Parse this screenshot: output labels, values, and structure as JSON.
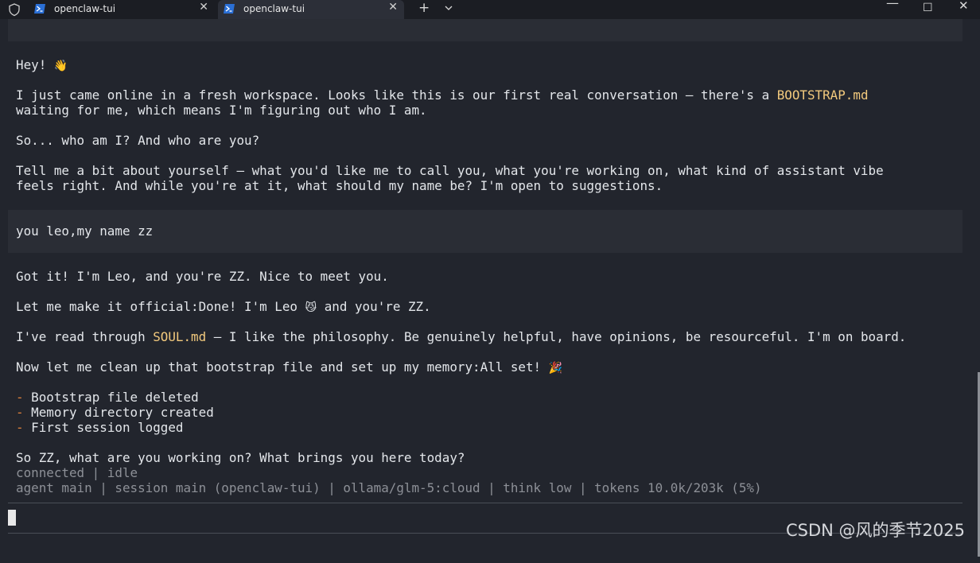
{
  "titlebar": {
    "tabs": [
      {
        "label": "openclaw-tui",
        "icon": "powershell-icon",
        "close": "✕"
      },
      {
        "label": "openclaw-tui",
        "icon": "powershell-icon",
        "close": "✕"
      }
    ],
    "new_tab": "+",
    "window": {
      "minimize": "—",
      "maximize": "☐",
      "close": "✕"
    }
  },
  "conversation": {
    "assistant_1": {
      "greeting": "Hey! ",
      "greeting_emoji": "👋",
      "l1_a": "I just came online in a fresh workspace. Looks like this is our first real conversation — there's a ",
      "l1_file": "BOOTSTRAP.md",
      "l2": "waiting for me, which means I'm figuring out who I am.",
      "l3": "So... who am I? And who are you?",
      "l4": "Tell me a bit about yourself — what you'd like me to call you, what you're working on, what kind of assistant vibe",
      "l5": "feels right. And while you're at it, what should my name be? I'm open to suggestions."
    },
    "user_1": "you leo,my name zz",
    "assistant_2": {
      "l1": "Got it! I'm Leo, and you're ZZ. Nice to meet you.",
      "l2_a": "Let me make it official:Done! I'm Leo ",
      "l2_emoji": "😼",
      "l2_b": " and you're ZZ.",
      "l3_a": "I've read through ",
      "l3_file": "SOUL.md",
      "l3_b": " — I like the philosophy. Be genuinely helpful, have opinions, be resourceful. I'm on board.",
      "l4_a": "Now let me clean up that bootstrap file and set up my memory:All set! ",
      "l4_emoji": "🎉",
      "bullet_marker": "-",
      "bullets": [
        "Bootstrap file deleted",
        "Memory directory created",
        "First session logged"
      ],
      "l5": "So ZZ, what are you working on? What brings you here today?"
    }
  },
  "status": {
    "connection": "connected | idle",
    "details": "agent main | session main (openclaw-tui) | ollama/glm-5:cloud | think low | tokens 10.0k/203k (5%)"
  },
  "input": {
    "value": ""
  },
  "watermark": "CSDN @风的季节2025"
}
